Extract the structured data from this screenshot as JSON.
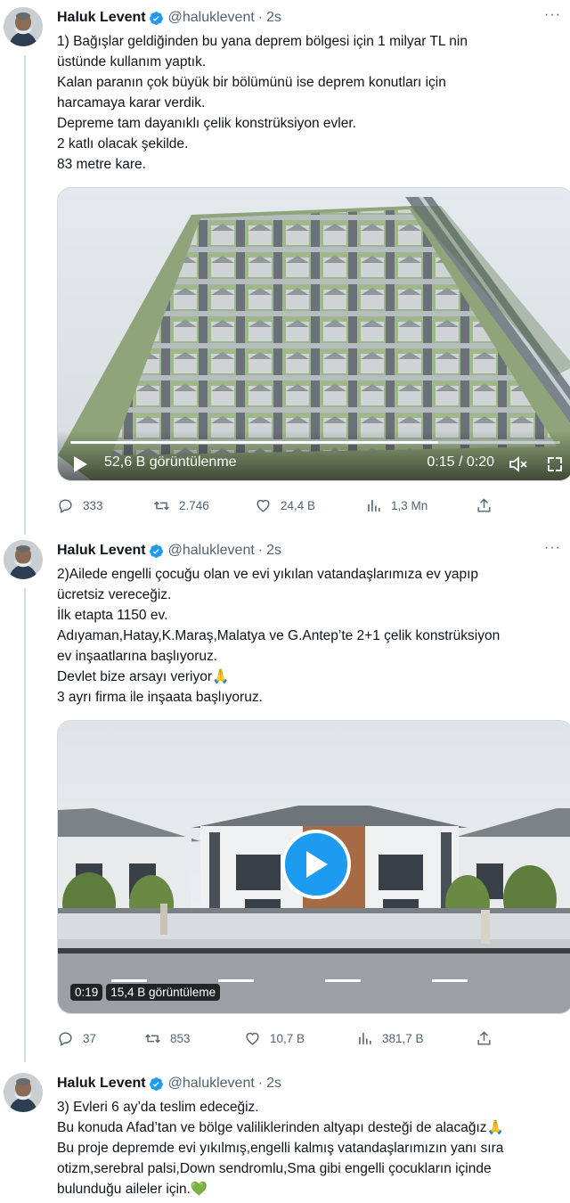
{
  "tweets": [
    {
      "author": "Haluk Levent",
      "handle": "@haluklevent",
      "separator": "·",
      "time": "2s",
      "more": "···",
      "lines": [
        "1) Bağışlar geldiğinden bu yana deprem bölgesi için 1 milyar TL nin",
        "üstünde kullanım yaptık.",
        "Kalan paranın çok büyük bir bölümünü ise deprem konutları için",
        "harcamaya karar verdik.",
        "Depreme tam dayanıklı çelik konstrüksiyon evler.",
        "2 katlı olacak şekilde.",
        "83 metre kare."
      ],
      "media": {
        "type": "video",
        "views_label": "52,6 B görüntülenme",
        "time_label": "0:15 / 0:20",
        "progress": 0.75
      },
      "actions": {
        "replies": "333",
        "retweets": "2.746",
        "likes": "24,4 B",
        "views": "1,3 Mn"
      }
    },
    {
      "author": "Haluk Levent",
      "handle": "@haluklevent",
      "separator": "·",
      "time": "2s",
      "more": "···",
      "lines": [
        "2)Ailede engelli çocuğu olan ve evi yıkılan vatandaşlarımıza ev yapıp",
        "ücretsiz vereceğiz.",
        "İlk etapta 1150 ev.",
        "Adıyaman,Hatay,K.Maraş,Malatya ve G.Antep’te 2+1 çelik konstrüksiyon",
        "ev inşaatlarına başlıyoruz.",
        "Devlet bize arsayı veriyor🙏",
        "3 ayrı firma ile inşaata başlıyoruz."
      ],
      "media": {
        "type": "video",
        "duration": "0:19",
        "views_label": "15,4 B görüntüleme"
      },
      "actions": {
        "replies": "37",
        "retweets": "853",
        "likes": "10,7 B",
        "views": "381,7 B"
      }
    },
    {
      "author": "Haluk Levent",
      "handle": "@haluklevent",
      "separator": "·",
      "time": "2s",
      "more": "",
      "lines": [
        "3) Evleri 6 ay’da teslim edeceğiz.",
        "Bu konuda Afad’tan ve bölge valiliklerinden altyapı desteği de alacağız🙏",
        "Bu proje depremde evi yıkılmış,engelli kalmış vatandaşlarımızın yanı sıra",
        "otizm,serebral palsi,Down sendromlu,Sma gibi engelli çocukların içinde",
        "bulunduğu aileler için.💚"
      ]
    }
  ],
  "colors": {
    "accent": "#1d9bf0",
    "text": "#0f1419",
    "muted": "#536471",
    "border": "#cfd9de"
  },
  "icons": [
    "verified-badge-icon",
    "reply-icon",
    "retweet-icon",
    "like-icon",
    "views-icon",
    "share-icon",
    "play-icon",
    "volume-icon",
    "fullscreen-icon"
  ]
}
